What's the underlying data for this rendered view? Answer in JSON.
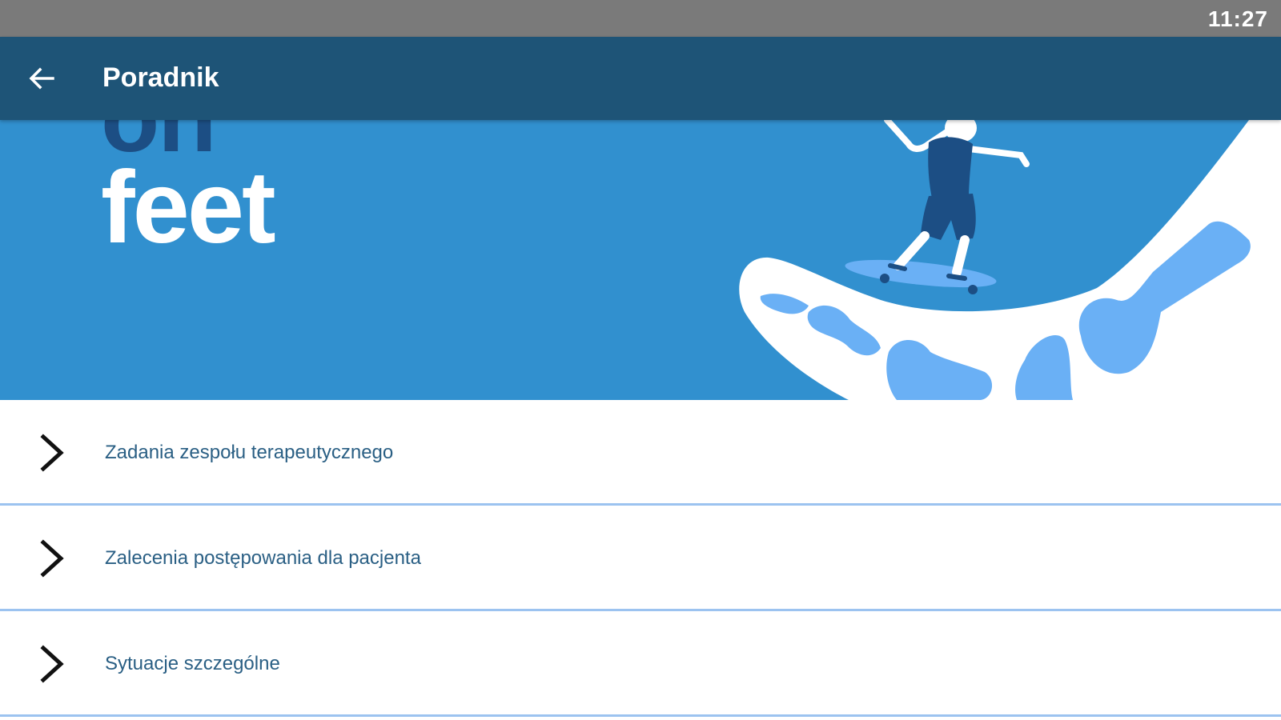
{
  "status_bar": {
    "time": "11:27"
  },
  "app_bar": {
    "title": "Poradnik",
    "back_icon": "arrow-left-icon"
  },
  "banner": {
    "partial_text": "on",
    "headline": "feet",
    "colors": {
      "background": "#3190cf",
      "accent_dark": "#1c4e84",
      "bone_light": "#6ab0f5"
    }
  },
  "menu": {
    "items": [
      {
        "label": "Zadania zespołu terapeutycznego",
        "icon": "chevron-right-icon"
      },
      {
        "label": "Zalecenia postępowania dla pacjenta",
        "icon": "chevron-right-icon"
      },
      {
        "label": "Sytuacje szczególne",
        "icon": "chevron-right-icon"
      }
    ]
  },
  "colors": {
    "app_bar": "#1e5477",
    "status_bar": "#7a7a7a",
    "divider": "#9cc3f0",
    "item_text": "#2a5f84"
  }
}
